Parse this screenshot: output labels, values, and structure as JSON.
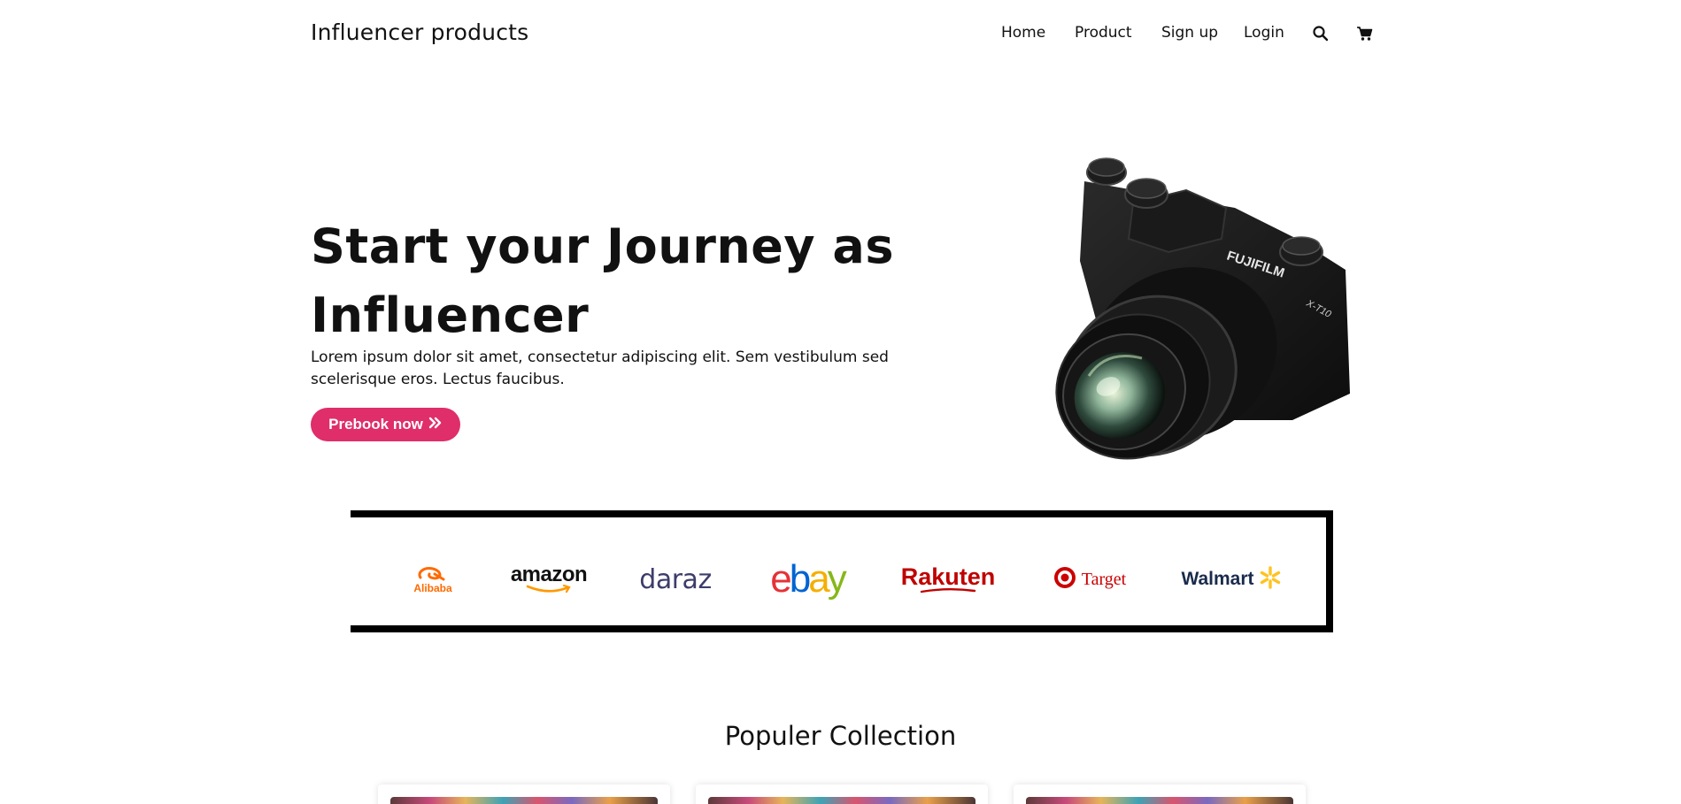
{
  "brand": {
    "name": "Influencer products"
  },
  "nav": {
    "items": [
      "Home",
      "Product",
      "Sign up",
      "Login"
    ]
  },
  "hero": {
    "title_line1": "Start your Journey as",
    "title_line2": "Influencer",
    "text": "Lorem ipsum dolor sit amet, consectetur adipiscing elit. Sem vestibulum sed scelerisque eros. Lectus faucibus.",
    "cta": "Prebook now",
    "cta_color": "#df2e6a",
    "camera_brand": "FUJIFILM",
    "camera_model": "X-T10"
  },
  "partners": {
    "alibaba": "Alibaba",
    "amazon": "amazon",
    "daraz": "daraz",
    "ebay": {
      "e": "e",
      "b": "b",
      "a": "a",
      "y": "y"
    },
    "rakuten": "Rakuten",
    "target": "Target",
    "walmart": "Walmart"
  },
  "collection": {
    "title": "Populer Collection"
  },
  "colors": {
    "accent": "#df2e6a",
    "text": "#111111",
    "ebay_red": "#e53238",
    "ebay_blue": "#0064d2",
    "ebay_yellow": "#f5af02",
    "ebay_green": "#86b817",
    "rakuten": "#bf0000",
    "target": "#cc0000",
    "walmart": "#1a2b4c",
    "walmart_spark": "#ffc220",
    "alibaba": "#ff6a00"
  },
  "icons": [
    "search-icon",
    "cart-icon",
    "double-chevron-right-icon"
  ]
}
